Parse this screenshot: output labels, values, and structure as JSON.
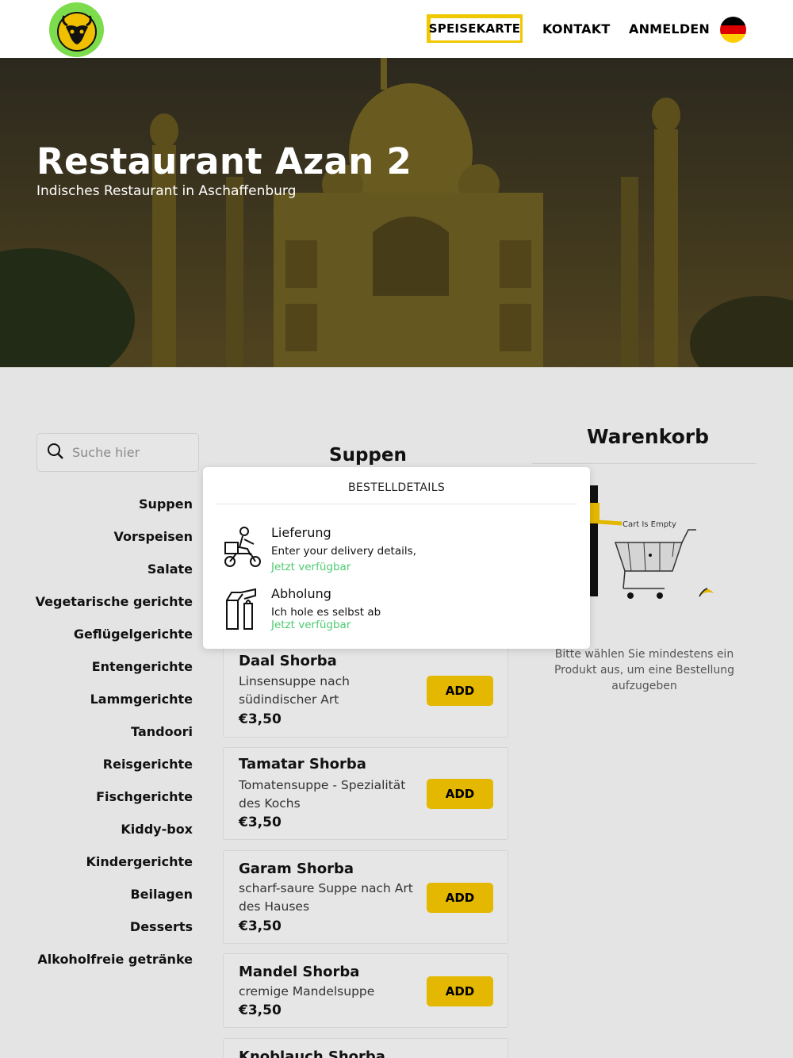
{
  "header": {
    "logo_icon": "goat-head-logo-icon",
    "nav": {
      "menu": "SPEISEKARTE",
      "contact": "KONTAKT",
      "login": "ANMELDEN"
    },
    "language_flag": "german-flag-icon",
    "accent_color": "#f0c800"
  },
  "hero": {
    "title": "Restaurant Azan 2",
    "subtitle": "Indisches Restaurant in Aschaffenburg"
  },
  "search": {
    "placeholder": "Suche hier",
    "icon": "search-icon"
  },
  "categories": [
    "Suppen",
    "Vorspeisen",
    "Salate",
    "Vegetarische gerichte",
    "Geflügelgerichte",
    "Entengerichte",
    "Lammgerichte",
    "Tandoori",
    "Reisgerichte",
    "Fischgerichte",
    "Kiddy-box",
    "Kindergerichte",
    "Beilagen",
    "Desserts",
    "Alkoholfreie getränke"
  ],
  "menu": {
    "section_title": "Suppen",
    "add_label": "ADD",
    "button_color": "#e4b800",
    "items": [
      {
        "name": "Daal Shorba",
        "description": "Linsensuppe nach südindischer Art",
        "price": "€3,50"
      },
      {
        "name": "Tamatar Shorba",
        "description": "Tomatensuppe - Spezialität des Kochs",
        "price": "€3,50"
      },
      {
        "name": "Garam Shorba",
        "description": "scharf-saure Suppe nach Art des Hauses",
        "price": "€3,50"
      },
      {
        "name": "Mandel Shorba",
        "description": "cremige Mandelsuppe",
        "price": "€3,50"
      },
      {
        "name": "Knoblauch Shorba",
        "description": "",
        "price": ""
      }
    ]
  },
  "cart": {
    "title": "Warenkorb",
    "empty_label": "Cart Is Empty",
    "message": "Bitte wählen Sie mindestens ein Produkt aus, um eine Bestellung aufzugeben"
  },
  "order_modal": {
    "title": "BESTELLDETAILS",
    "delivery": {
      "title": "Lieferung",
      "description": "Enter your delivery details,",
      "availability": "Jetzt verfügbar",
      "icon": "delivery-scooter-icon"
    },
    "pickup": {
      "title": "Abholung",
      "description": "Ich hole es selbst ab",
      "availability": "Jetzt verfügbar",
      "icon": "pickup-bag-icon"
    },
    "availability_color": "#4ecb71"
  }
}
